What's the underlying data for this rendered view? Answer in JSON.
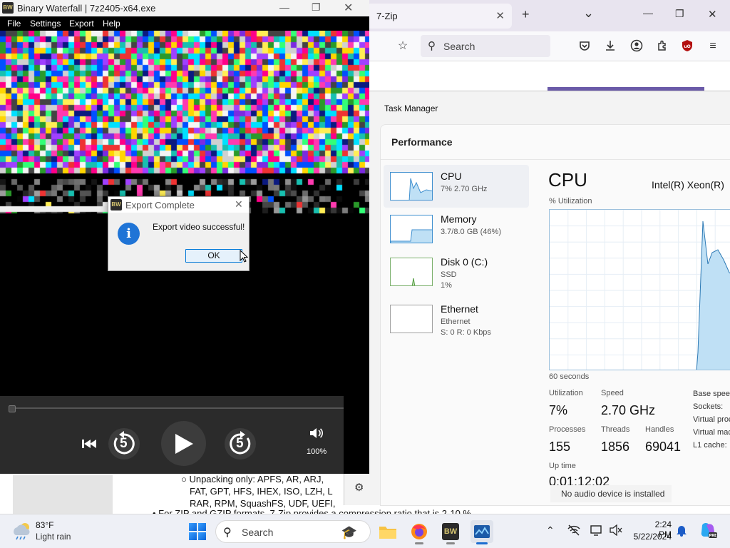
{
  "browser": {
    "tab_title": "7-Zip",
    "tab_close": "✕",
    "new_tab": "+",
    "tab_list": "⌄",
    "minimize": "—",
    "maximize": "❐",
    "close": "✕",
    "search_placeholder": "Search",
    "doc_lines": [
      "○ Unpacking only: APFS, AR, ARJ,",
      "FAT, GPT, HFS, IHEX, ISO, LZH, L",
      "RAR, RPM, SquashFS, UDF, UEFI,",
      "• For ZIP and GZIP formats, 7-Zip provides a compression ratio that is 2-10 %"
    ]
  },
  "binary_waterfall": {
    "title": "Binary Waterfall | 7z2405-x64.exe",
    "logo": "BW",
    "menu": [
      "File",
      "Settings",
      "Export",
      "Help"
    ],
    "volume": "100%",
    "rewind_seconds": "5",
    "forward_seconds": "5"
  },
  "dialog": {
    "title": "Export Complete",
    "message": "Export video successful!",
    "ok_label": "OK",
    "info_glyph": "i"
  },
  "task_manager": {
    "title": "Task Manager",
    "section": "Performance",
    "resources": [
      {
        "name": "CPU",
        "sub1": "7% 2.70 GHz",
        "sub2": ""
      },
      {
        "name": "Memory",
        "sub1": "3.7/8.0 GB (46%)",
        "sub2": ""
      },
      {
        "name": "Disk 0 (C:)",
        "sub1": "SSD",
        "sub2": "1%"
      },
      {
        "name": "Ethernet",
        "sub1": "Ethernet",
        "sub2": "S: 0 R: 0 Kbps"
      }
    ],
    "cpu_heading": "CPU",
    "cpu_model": "Intel(R) Xeon(R)",
    "util_label": "% Utilization",
    "graph_window": "60 seconds",
    "stats": {
      "utilization_label": "Utilization",
      "utilization": "7%",
      "speed_label": "Speed",
      "speed": "2.70 GHz",
      "processes_label": "Processes",
      "processes": "155",
      "threads_label": "Threads",
      "threads": "1856",
      "handles_label": "Handles",
      "handles": "69041",
      "uptime_label": "Up time",
      "uptime": "0:01:12:02"
    },
    "right_labels": [
      "Base speed:",
      "Sockets:",
      "Virtual processors:",
      "Virtual machine:",
      "L1 cache:"
    ]
  },
  "notification": "No audio device is installed",
  "taskbar": {
    "temperature": "83°F",
    "condition": "Light rain",
    "search_placeholder": "Search",
    "time": "2:24 PM",
    "date": "5/22/2024"
  }
}
